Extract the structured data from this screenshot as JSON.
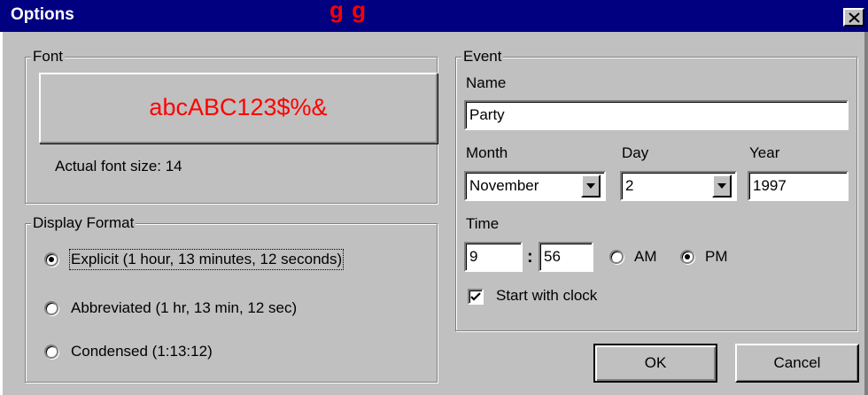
{
  "window": {
    "title": "Options",
    "title_deco": "g g"
  },
  "font_group": {
    "label": "Font",
    "preview_text": "abcABC123$%&",
    "actual_size_label": "Actual font size: 14"
  },
  "display_format": {
    "label": "Display Format",
    "options": [
      {
        "label": "Explicit (1 hour, 13 minutes, 12 seconds)",
        "selected": true
      },
      {
        "label": "Abbreviated (1 hr, 13 min, 12 sec)",
        "selected": false
      },
      {
        "label": "Condensed (1:13:12)",
        "selected": false
      }
    ]
  },
  "event": {
    "label": "Event",
    "name_label": "Name",
    "name_value": "Party",
    "month_label": "Month",
    "month_value": "November",
    "day_label": "Day",
    "day_value": "2",
    "year_label": "Year",
    "year_value": "1997",
    "time_label": "Time",
    "hour_value": "9",
    "time_sep": ":",
    "minute_value": "56",
    "am_label": "AM",
    "pm_label": "PM",
    "ampm_selected": "PM",
    "start_with_clock_label": "Start with clock",
    "start_with_clock_checked": true
  },
  "buttons": {
    "ok": "OK",
    "cancel": "Cancel"
  },
  "colors": {
    "title_bar": "#000080",
    "face": "#c0c0c0",
    "preview_text": "#ff0000"
  }
}
